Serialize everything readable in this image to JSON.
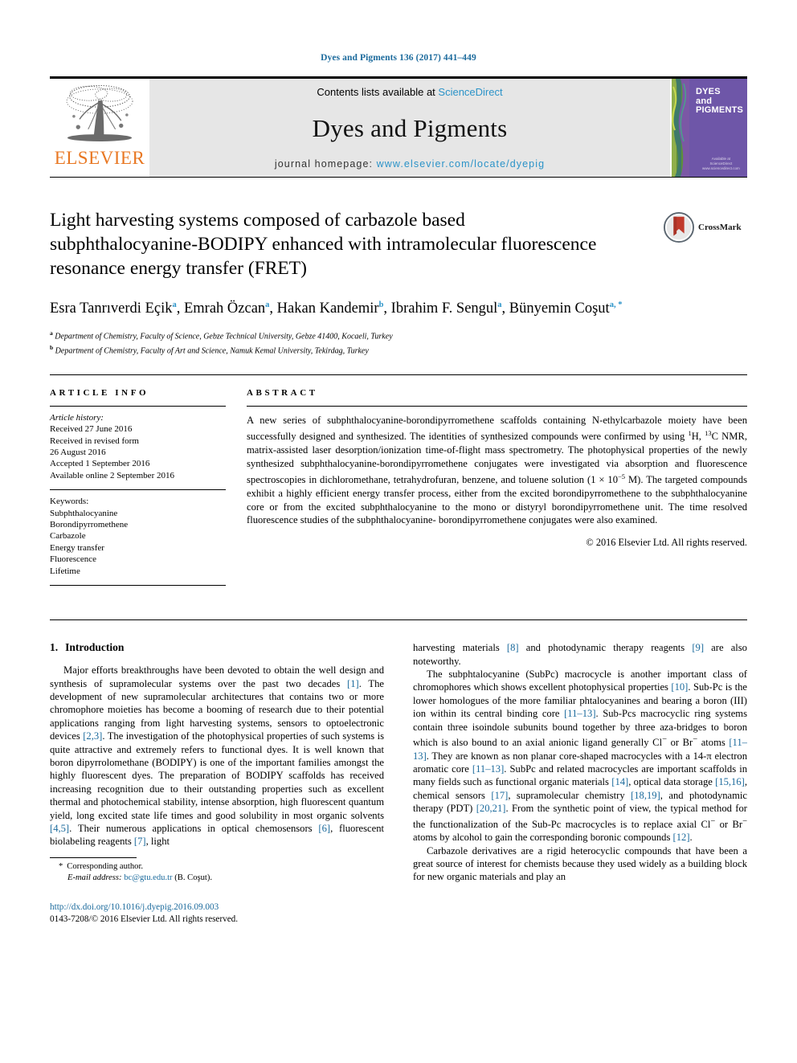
{
  "running_head": "Dyes and Pigments 136 (2017) 441–449",
  "masthead": {
    "publisher_name": "ELSEVIER",
    "contents_prefix": "Contents lists available at ",
    "contents_link": "ScienceDirect",
    "journal_title": "Dyes and Pigments",
    "homepage_prefix": "journal homepage: ",
    "homepage_link": "www.elsevier.com/locate/dyepig",
    "cover_title_line1": "DYES",
    "cover_title_line2": "and",
    "cover_title_line3": "PIGMENTS",
    "cover_foot_line1": "Available at",
    "cover_foot_line2": "ScienceDirect",
    "cover_foot_line3": "www.sciencedirect.com"
  },
  "article": {
    "title": "Light harvesting systems composed of carbazole based subphthalocyanine-BODIPY enhanced with intramolecular fluorescence resonance energy transfer (FRET)",
    "crossmark_label": "CrossMark",
    "authors": [
      {
        "name": "Esra Tanrıverdi Eçik",
        "marks": "a"
      },
      {
        "name": "Emrah Özcan",
        "marks": "a"
      },
      {
        "name": "Hakan Kandemir",
        "marks": "b"
      },
      {
        "name": "Ibrahim F. Sengul",
        "marks": "a"
      },
      {
        "name": "Bünyemin Coşut",
        "marks": "a, *"
      }
    ],
    "affiliations": [
      {
        "mark": "a",
        "text": "Department of Chemistry, Faculty of Science, Gebze Technical University, Gebze 41400, Kocaeli, Turkey"
      },
      {
        "mark": "b",
        "text": "Department of Chemistry, Faculty of Art and Science, Namuk Kemal University, Tekirdag, Turkey"
      }
    ]
  },
  "article_info": {
    "heading": "ARTICLE INFO",
    "history_label": "Article history:",
    "history": [
      "Received 27 June 2016",
      "Received in revised form",
      "26 August 2016",
      "Accepted 1 September 2016",
      "Available online 2 September 2016"
    ],
    "keywords_label": "Keywords:",
    "keywords": [
      "Subphthalocyanine",
      "Borondipyrromethene",
      "Carbazole",
      "Energy transfer",
      "Fluorescence",
      "Lifetime"
    ]
  },
  "abstract": {
    "heading": "ABSTRACT",
    "paragraph_part1": "A new series of subphthalocyanine-borondipyrromethene scaffolds containing N-ethylcarbazole moiety have been successfully designed and synthesized. The identities of synthesized compounds were confirmed by using ",
    "nmr_1h_sup": "1",
    "nmr_1h": "H, ",
    "nmr_13c_sup": "13",
    "nmr_13c": "C NMR, ",
    "paragraph_part2": "matrix-assisted laser desorption/ionization time-of-flight mass spectrometry. The photophysical properties of the newly synthesized subphthalocyanine-borondipyrromethene conjugates were investigated via absorption and fluorescence spectroscopies in dichloromethane, tetrahydrofuran, benzene, and toluene solution (1 × 10",
    "conc_exp": "−5",
    "paragraph_part3": " M). The targeted compounds exhibit a highly efficient energy transfer process, either from the excited borondipyrromethene to the subphthalocyanine core or from the excited subphthalocyanine to the mono or distyryl borondipyrromethene unit. The time resolved fluorescence studies of the subphthalocyanine- borondipyrromethene conjugates were also examined.",
    "copyright": "© 2016 Elsevier Ltd. All rights reserved."
  },
  "introduction": {
    "number": "1.",
    "title": "Introduction",
    "left_paragraph_1_a": "Major efforts breakthroughs have been devoted to obtain the well design and synthesis of supramolecular systems over the past two decades ",
    "ref1": "[1]",
    "left_paragraph_1_b": ". The development of new supramolecular architectures that contains two or more chromophore moieties has become a booming of research due to their potential applications ranging from light harvesting systems, sensors to optoelectronic devices ",
    "ref23": "[2,3]",
    "left_paragraph_1_c": ". The investigation of the photophysical properties of such systems is quite attractive and extremely refers to functional dyes. It is well known that boron dipyrrolomethane (BODIPY) is one of the important families amongst the highly fluorescent dyes. The preparation of BODIPY scaffolds has received increasing recognition due to their outstanding properties such as excellent thermal and photochemical stability, intense absorption, high fluorescent quantum yield, long excited state life times and good solubility in most organic solvents ",
    "ref45": "[4,5]",
    "left_paragraph_1_d": ". Their numerous applications in optical chemosensors ",
    "ref6": "[6]",
    "left_paragraph_1_e": ", fluorescent biolabeling reagents ",
    "ref7": "[7]",
    "left_paragraph_1_f": ", light",
    "right_paragraph_1_a": "harvesting materials ",
    "ref8": "[8]",
    "right_paragraph_1_b": " and photodynamic therapy reagents ",
    "ref9": "[9]",
    "right_paragraph_1_c": " are also noteworthy.",
    "right_paragraph_2_a": "The subphtalocyanine (SubPc) macrocycle is another important class of chromophores which shows excellent photophysical properties ",
    "ref10": "[10]",
    "right_paragraph_2_b": ". Sub-Pc is the lower homologues of the more familiar phtalocyanines and bearing a boron (III) ion within its central binding core ",
    "ref1113a": "[11–13]",
    "right_paragraph_2_c": ". Sub-Pcs macrocyclic ring systems contain three isoindole subunits bound together by three aza-bridges to boron which is also bound to an axial anionic ligand generally Cl",
    "cl_sup": "−",
    "right_paragraph_2_d": " or Br",
    "br_sup": "−",
    "right_paragraph_2_e": " atoms ",
    "ref1113b": "[11–13]",
    "right_paragraph_2_f": ". They are known as non planar core-shaped macrocycles with a 14-π electron aromatic core ",
    "ref1113c": "[11–13]",
    "right_paragraph_2_g": ". SubPc and related macrocycles are important scaffolds in many fields such as functional organic materials ",
    "ref14": "[14]",
    "right_paragraph_2_h": ", optical data storage ",
    "ref1516": "[15,16]",
    "right_paragraph_2_i": ", chemical sensors ",
    "ref17": "[17]",
    "right_paragraph_2_j": ", supramolecular chemistry ",
    "ref1819": "[18,19]",
    "right_paragraph_2_k": ", and photodynamic therapy (PDT) ",
    "ref2021": "[20,21]",
    "right_paragraph_2_l": ". From the synthetic point of view, the typical method for the functionalization of the Sub-Pc macrocycles is to replace axial Cl",
    "cl_sup2": "−",
    "right_paragraph_2_m": " or Br",
    "br_sup2": "−",
    "right_paragraph_2_n": " atoms by alcohol to gain the corresponding boronic compounds ",
    "ref12": "[12]",
    "right_paragraph_2_o": ".",
    "right_paragraph_3": "Carbazole derivatives are a rigid heterocyclic compounds that have been a great source of interest for chemists because they used widely as a building block for new organic materials and play an"
  },
  "footnotes": {
    "star": "*",
    "corresponding_author": "Corresponding author.",
    "email_label": "E-mail address:",
    "email": "bc@gtu.edu.tr",
    "email_suffix": "(B. Coşut).",
    "doi_link": "http://dx.doi.org/10.1016/j.dyepig.2016.09.003",
    "issn_line": "0143-7208/© 2016 Elsevier Ltd. All rights reserved."
  },
  "colors": {
    "link_blue": "#2b93c8",
    "ref_blue": "#1b6a9c",
    "elsevier_orange": "#e87722",
    "masthead_gray": "#e6e6e6",
    "cover_purple": "#6e56a8"
  }
}
